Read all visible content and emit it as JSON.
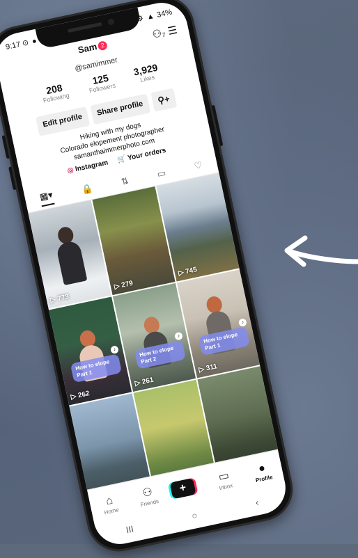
{
  "status_bar": {
    "time": "9:17",
    "left_icons": "⊙ ● ◎",
    "right_icons": "⚙ ▲",
    "battery": "34%"
  },
  "profile": {
    "username": "Sam",
    "notif_count": "2",
    "handle": "@samimmer",
    "top_icons": "⚇₇ ☰"
  },
  "stats": [
    {
      "num": "208",
      "label": "Following"
    },
    {
      "num": "125",
      "label": "Followers"
    },
    {
      "num": "3,929",
      "label": "Likes"
    }
  ],
  "actions": {
    "edit": "Edit profile",
    "share": "Share profile",
    "add_friend_icon": "person-plus-icon"
  },
  "bio": {
    "line1": "Hiking with my dogs",
    "line2": "Colorado elopement photographer",
    "line3": "samanthaimmerphoto.com"
  },
  "links": {
    "instagram": "Instagram",
    "orders": "Your orders"
  },
  "grid": [
    {
      "views": "773",
      "overlay": ""
    },
    {
      "views": "279",
      "overlay": ""
    },
    {
      "views": "745",
      "overlay": ""
    },
    {
      "views": "262",
      "overlay": "How to elope Part 1"
    },
    {
      "views": "261",
      "overlay": "How to elope Part 2"
    },
    {
      "views": "311",
      "overlay": "How to elope Part 1"
    }
  ],
  "nav": {
    "home": "Home",
    "friends": "Friends",
    "inbox": "Inbox",
    "profile": "Profile",
    "plus": "+"
  },
  "sysnav": {
    "recent": "III",
    "home": "○",
    "back": "‹"
  },
  "colors": {
    "accent": "#fe2c55",
    "cyan": "#25f4ee",
    "background": "#5c6a7c"
  }
}
